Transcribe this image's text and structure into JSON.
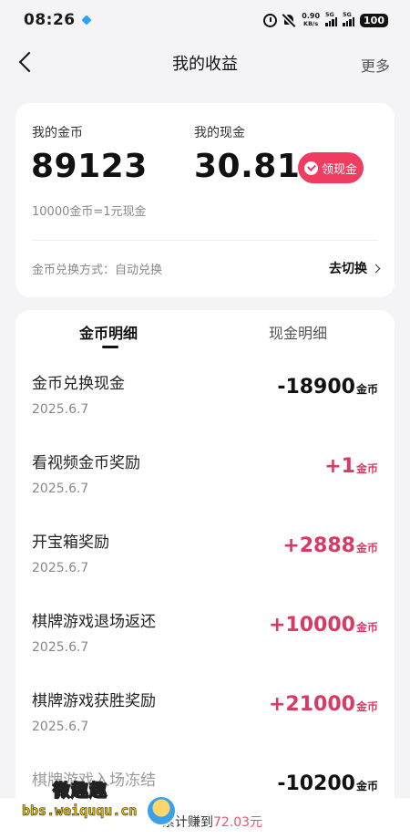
{
  "status_bar": {
    "time": "08:26",
    "net_speed_value": "0.90",
    "net_speed_unit": "KB/s",
    "signal_1_tag": "5G",
    "signal_2_tag": "5G",
    "battery": "100"
  },
  "header": {
    "title": "我的收益",
    "more": "更多"
  },
  "summary": {
    "coins_label": "我的金币",
    "coins_value": "89123",
    "cash_label": "我的现金",
    "cash_value": "30.81",
    "claim_button": "领现金",
    "rate_text": "10000金币=1元现金",
    "method_label": "金币兑换方式：自动兑换",
    "switch_link": "去切换"
  },
  "tabs": [
    {
      "label": "金币明细",
      "active": true
    },
    {
      "label": "现金明细",
      "active": false
    }
  ],
  "records": [
    {
      "title": "金币兑换现金",
      "date": "2025.6.7",
      "amount": "-18900",
      "unit": "金币",
      "sign": "neg"
    },
    {
      "title": "看视频金币奖励",
      "date": "2025.6.7",
      "amount": "+1",
      "unit": "金币",
      "sign": "pos"
    },
    {
      "title": "开宝箱奖励",
      "date": "2025.6.7",
      "amount": "+2888",
      "unit": "金币",
      "sign": "pos"
    },
    {
      "title": "棋牌游戏退场返还",
      "date": "2025.6.7",
      "amount": "+10000",
      "unit": "金币",
      "sign": "pos"
    },
    {
      "title": "棋牌游戏获胜奖励",
      "date": "2025.6.7",
      "amount": "+21000",
      "unit": "金币",
      "sign": "pos"
    },
    {
      "title": "棋牌游戏入场冻结",
      "date": "",
      "amount": "-10200",
      "unit": "金币",
      "sign": "neg"
    }
  ],
  "banner": {
    "prefix": "累计赚到",
    "amount": "72.03元"
  },
  "watermark": {
    "cn": "微趣趣",
    "url": "bbs.weiququ.cn"
  },
  "colors": {
    "accent": "#ef3c60",
    "positive": "#d93a64",
    "background": "#f4f4f6"
  }
}
